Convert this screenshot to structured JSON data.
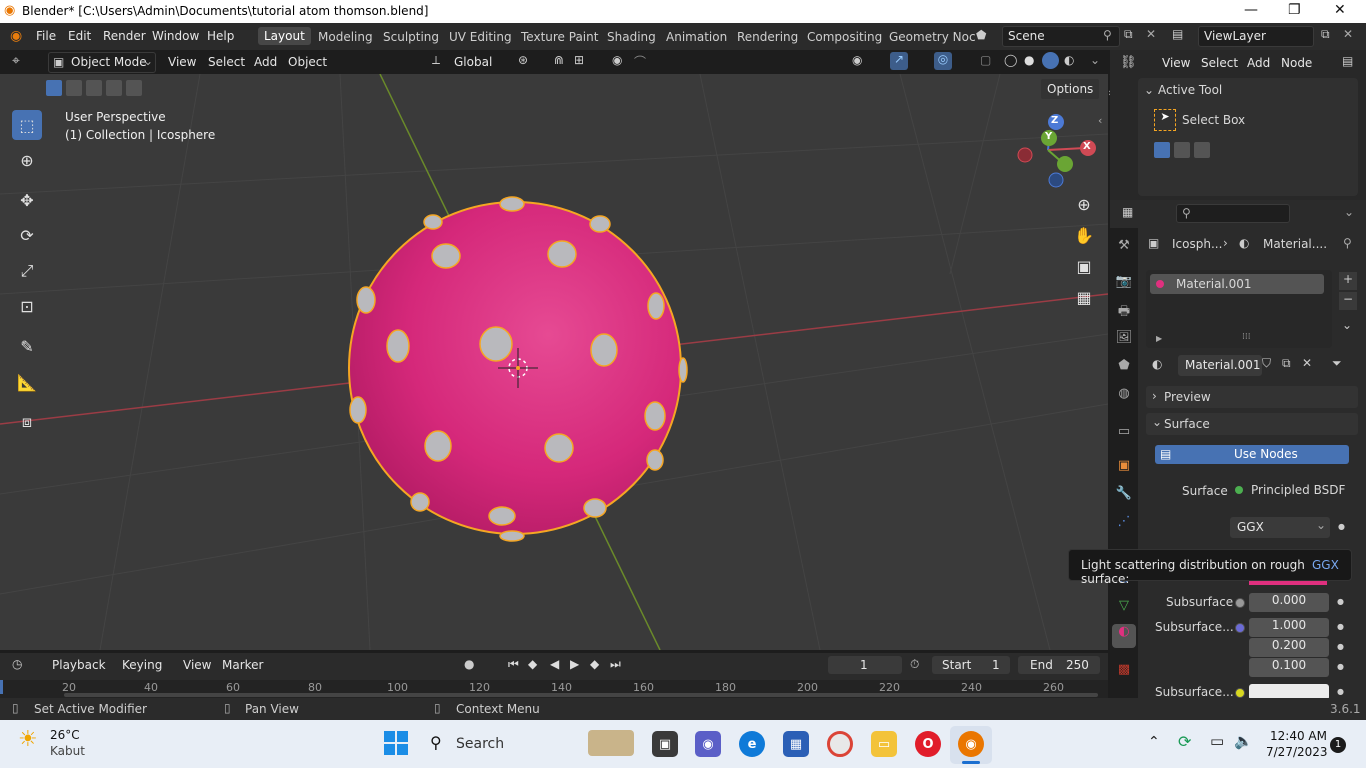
{
  "window": {
    "title": "Blender* [C:\\Users\\Admin\\Documents\\tutorial atom thomson.blend]",
    "minimize": "—",
    "maximize": "❐",
    "close": "✕"
  },
  "menubar": {
    "items": [
      "File",
      "Edit",
      "Render",
      "Window",
      "Help"
    ]
  },
  "workspaces": {
    "tabs": [
      "Layout",
      "Modeling",
      "Sculpting",
      "UV Editing",
      "Texture Paint",
      "Shading",
      "Animation",
      "Rendering",
      "Compositing",
      "Geometry Noc"
    ],
    "active": "Layout"
  },
  "scene": {
    "label": "Scene",
    "viewlayer": "ViewLayer"
  },
  "viewport_header": {
    "mode": "Object Mode",
    "menus": [
      "View",
      "Select",
      "Add",
      "Object"
    ],
    "orientation": "Global",
    "options": "Options"
  },
  "viewport": {
    "perspective": "User Perspective",
    "collection": "(1) Collection | Icosphere",
    "sphere_color": "#d5287a",
    "outline_color": "#f5a623",
    "gizmo": {
      "z": "Z",
      "y": "Y",
      "x": "X"
    }
  },
  "node_header": {
    "menus": [
      "View",
      "Select",
      "Add",
      "Node"
    ]
  },
  "active_tool": {
    "header": "Active Tool",
    "tool": "Select Box"
  },
  "properties": {
    "breadcrumb_object": "Icosph...",
    "breadcrumb_material": "Material....",
    "slot": "Material.001",
    "material_name": "Material.001",
    "preview": "Preview",
    "surface_section": "Surface",
    "use_nodes": "Use Nodes",
    "surface_label": "Surface",
    "surface_value": "Principled BSDF",
    "distribution": "GGX",
    "tooltip_text": "Light scattering distribution on rough surface:",
    "tooltip_value": "GGX",
    "subsurface_label": "Subsurface",
    "subsurface_value": "0.000",
    "subsurface_radius_label": "Subsurface...",
    "radius": [
      "1.000",
      "0.200",
      "0.100"
    ],
    "subsurface_color_label": "Subsurface..."
  },
  "timeline": {
    "menus": [
      "Playback",
      "Keying",
      "View",
      "Marker"
    ],
    "current_frame": "1",
    "start_label": "Start",
    "start": "1",
    "end_label": "End",
    "end": "250",
    "ruler": [
      "20",
      "40",
      "60",
      "80",
      "100",
      "120",
      "140",
      "160",
      "180",
      "200",
      "220",
      "240",
      "260"
    ]
  },
  "statusbar": {
    "left": "Set Active Modifier",
    "middle": "Pan View",
    "right": "Context Menu",
    "version": "3.6.1"
  },
  "taskbar": {
    "temp": "26°C",
    "weather": "Kabut",
    "search": "Search",
    "time": "12:40 AM",
    "date": "7/27/2023",
    "notif": "1"
  }
}
